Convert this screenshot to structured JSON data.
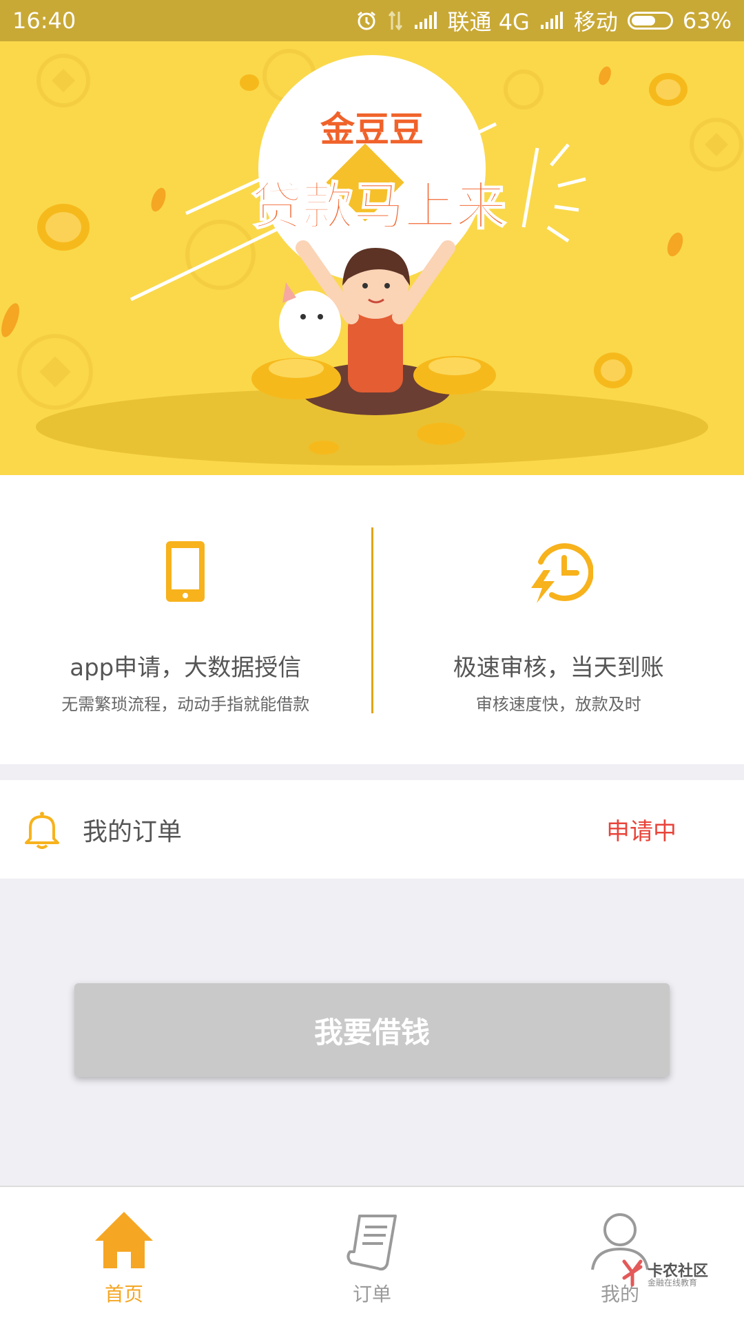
{
  "status_bar": {
    "time": "16:40",
    "carrier1": "联通 4G",
    "carrier2": "移动",
    "battery": "63%",
    "battery_level": 0.63
  },
  "banner": {
    "brand": "金豆豆",
    "slogan": "贷款马上来"
  },
  "features": [
    {
      "icon": "phone-icon",
      "title": "app申请，大数据授信",
      "subtitle": "无需繁琐流程，动动手指就能借款"
    },
    {
      "icon": "fast-clock-icon",
      "title": "极速审核，当天到账",
      "subtitle": "审核速度快，放款及时"
    }
  ],
  "order": {
    "icon": "bell-icon",
    "label": "我的订单",
    "status": "申请中"
  },
  "borrow_button": "我要借钱",
  "nav": [
    {
      "icon": "home-icon",
      "label": "首页",
      "active": true
    },
    {
      "icon": "orders-icon",
      "label": "订单",
      "active": false
    },
    {
      "icon": "profile-icon",
      "label": "我的",
      "active": false
    }
  ],
  "watermark": {
    "title": "卡农社区",
    "subtitle": "金融在线教育"
  },
  "colors": {
    "status_bar": "#c9a936",
    "banner_bg": "#fad84a",
    "accent": "#f5a623",
    "divider": "#e1a317",
    "status_red": "#e8443a",
    "button_disabled": "#c9c9c9"
  }
}
